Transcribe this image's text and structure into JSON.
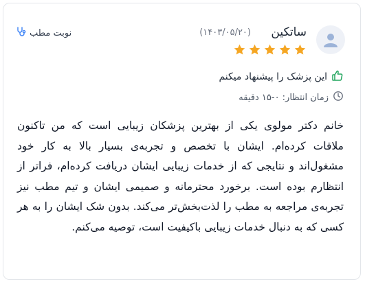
{
  "review": {
    "author_name": "ساتکین",
    "date": "(۱۴۰۳/۰۵/۲۰)",
    "rating": 5,
    "rating_max": 5,
    "visit_type": "نوبت مطب",
    "recommendation": "این پزشک را پیشنهاد میکنم",
    "wait_time": "زمان انتظار: ۰-۱۵ دقیقه",
    "text": "خانم دکتر مولوی یکی از بهترین پزشکان زیبایی است که من تاکنون ملاقات کرده‌ام. ایشان با تخصص و تجربه‌ی بسیار بالا به کار خود مشغول‌اند و نتایجی که از خدمات زیبایی ایشان دریافت کرده‌ام، فراتر از انتظارم بوده است. برخورد محترمانه و صمیمی ایشان و تیم مطب نیز تجربه‌ی مراجعه به مطب را لذت‌بخش‌تر می‌کند. بدون شک ایشان را به هر کسی که به دنبال خدمات زیبایی باکیفیت است، توصیه می‌کنم."
  },
  "icons": {
    "avatar": "user-avatar-icon",
    "star": "star-icon",
    "stethoscope": "stethoscope-icon",
    "thumbs_up": "thumbs-up-icon",
    "clock": "clock-icon"
  },
  "colors": {
    "star": "#f5a623",
    "thumbs_up": "#22a55e",
    "avatar_bg": "#eef1f7",
    "avatar_fg": "#9cb3d8",
    "stethoscope": "#3b82f6",
    "border": "#e3e6ea"
  }
}
